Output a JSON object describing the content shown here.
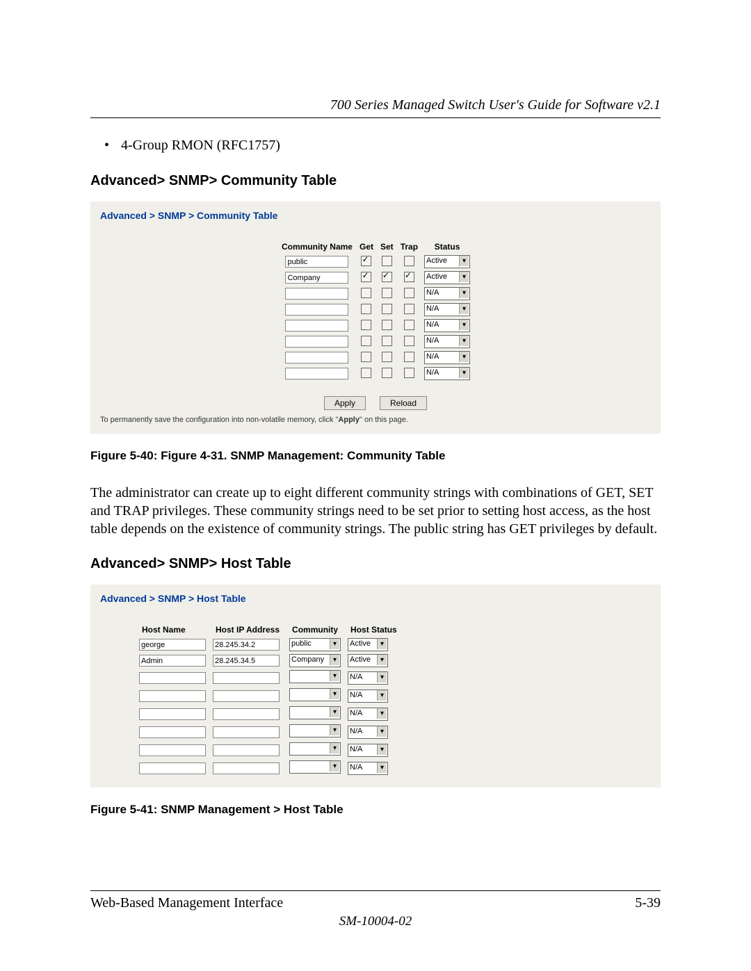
{
  "header": {
    "title": "700 Series Managed Switch User's Guide for Software v2.1"
  },
  "bullet": "4-Group RMON (RFC1757)",
  "sec1": {
    "heading": "Advanced> SNMP> Community Table",
    "path": "Advanced > SNMP > Community Table",
    "cols": {
      "name": "Community Name",
      "get": "Get",
      "set": "Set",
      "trap": "Trap",
      "status": "Status"
    },
    "rows": [
      {
        "name": "public",
        "get": true,
        "set": false,
        "trap": false,
        "status": "Active"
      },
      {
        "name": "Company",
        "get": true,
        "set": true,
        "trap": true,
        "status": "Active"
      },
      {
        "name": "",
        "get": false,
        "set": false,
        "trap": false,
        "status": "N/A"
      },
      {
        "name": "",
        "get": false,
        "set": false,
        "trap": false,
        "status": "N/A"
      },
      {
        "name": "",
        "get": false,
        "set": false,
        "trap": false,
        "status": "N/A"
      },
      {
        "name": "",
        "get": false,
        "set": false,
        "trap": false,
        "status": "N/A"
      },
      {
        "name": "",
        "get": false,
        "set": false,
        "trap": false,
        "status": "N/A"
      },
      {
        "name": "",
        "get": false,
        "set": false,
        "trap": false,
        "status": "N/A"
      }
    ],
    "apply": "Apply",
    "reload": "Reload",
    "hint_pre": "To permanently save the configuration into non-volatile memory, click \"",
    "hint_bold": "Apply",
    "hint_post": "\" on this page.",
    "caption": "Figure 5-40:  Figure 4-31. SNMP Management: Community Table"
  },
  "para": "The administrator can create up to eight different community strings with combinations of GET, SET and TRAP privileges.  These community strings need to be set prior to setting host access, as the host table depends on the existence of community strings.  The public string has GET privileges by default.",
  "sec2": {
    "heading": "Advanced> SNMP> Host Table",
    "path": "Advanced > SNMP > Host Table",
    "cols": {
      "name": "Host Name",
      "ip": "Host IP Address",
      "comm": "Community",
      "status": "Host Status"
    },
    "rows": [
      {
        "name": "george",
        "ip": "28.245.34.2",
        "community": "public",
        "status": "Active"
      },
      {
        "name": "Admin",
        "ip": "28.245.34.5",
        "community": "Company",
        "status": "Active"
      },
      {
        "name": "",
        "ip": "",
        "community": "",
        "status": "N/A"
      },
      {
        "name": "",
        "ip": "",
        "community": "",
        "status": "N/A"
      },
      {
        "name": "",
        "ip": "",
        "community": "",
        "status": "N/A"
      },
      {
        "name": "",
        "ip": "",
        "community": "",
        "status": "N/A"
      },
      {
        "name": "",
        "ip": "",
        "community": "",
        "status": "N/A"
      },
      {
        "name": "",
        "ip": "",
        "community": "",
        "status": "N/A"
      }
    ],
    "caption": "Figure 5-41:  SNMP Management > Host Table"
  },
  "footer": {
    "left": "Web-Based Management Interface",
    "right": "5-39",
    "docid": "SM-10004-02"
  }
}
